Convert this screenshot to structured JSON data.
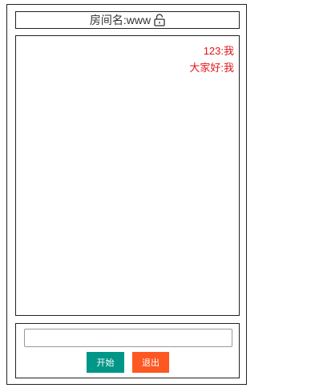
{
  "room": {
    "label": "房间名:www",
    "lock_icon": "unlock-icon"
  },
  "messages": [
    {
      "text": "123:我"
    },
    {
      "text": "大家好:我"
    }
  ],
  "colors": {
    "message_text": "#e0161b",
    "start_button": "#009688",
    "exit_button": "#ff5722"
  },
  "input": {
    "value": "",
    "placeholder": ""
  },
  "buttons": {
    "start_label": "开始",
    "exit_label": "退出"
  }
}
